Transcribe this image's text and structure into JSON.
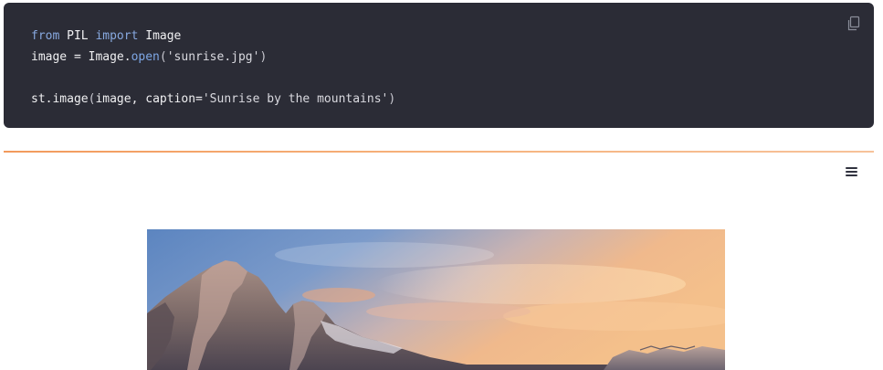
{
  "code": {
    "line1": {
      "kw_from": "from",
      "module": " PIL ",
      "kw_import": "import",
      "name": " Image"
    },
    "line2": {
      "var": "image = Image.",
      "method": "open",
      "open_paren": "(",
      "arg": "'sunrise.jpg'",
      "close_paren": ")"
    },
    "line3": "",
    "line4": {
      "obj": "st.image",
      "open_paren": "(",
      "args": "image, caption=",
      "arg": "'Sunrise by the mountains'",
      "close_paren": ")"
    }
  },
  "copy_icon": "copy-icon",
  "menu_icon": "hamburger-menu-icon",
  "image": {
    "description_icon": "sunrise-mountain-photo"
  },
  "colors": {
    "code_bg": "#2b2c36",
    "keyword": "#88a9e0",
    "divider_start": "#f29a5c",
    "divider_end": "#f7c29a"
  }
}
